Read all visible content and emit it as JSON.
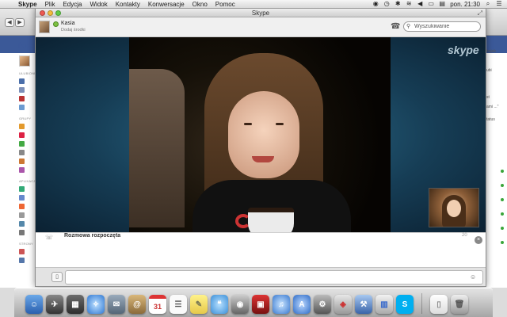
{
  "menubar": {
    "app": "Skype",
    "items": [
      "Plik",
      "Edycja",
      "Widok",
      "Kontakty",
      "Konwersacje",
      "Okno",
      "Pomoc"
    ],
    "clock": "pon. 21:30"
  },
  "browser": {
    "logo": "face",
    "section_labels": [
      "ULUBIONE",
      "GRUPY",
      "APLIKACJE",
      "STRONY"
    ],
    "right_fragments": [
      "bojak",
      "ubi",
      "st",
      "ami ...\"",
      "tatus"
    ]
  },
  "skype": {
    "window_title": "Skype",
    "contact": {
      "name": "Kasia",
      "mood": "Dodaj środki"
    },
    "search_placeholder": "Wyszukiwanie",
    "watermark": "skype",
    "chat": {
      "event": "Rozmowa rozpoczęta",
      "time": "20"
    }
  },
  "dock": {
    "calendar_day": "31"
  },
  "colors": {
    "facebook_blue": "#3b5998",
    "skype_blue": "#00aff0",
    "video_bg": "#163d55",
    "online_green": "#7dc142"
  },
  "icons": {
    "apple": "apple-logo-icon",
    "search": "magnifier-icon",
    "phone": "phone-icon",
    "close": "close-icon"
  }
}
